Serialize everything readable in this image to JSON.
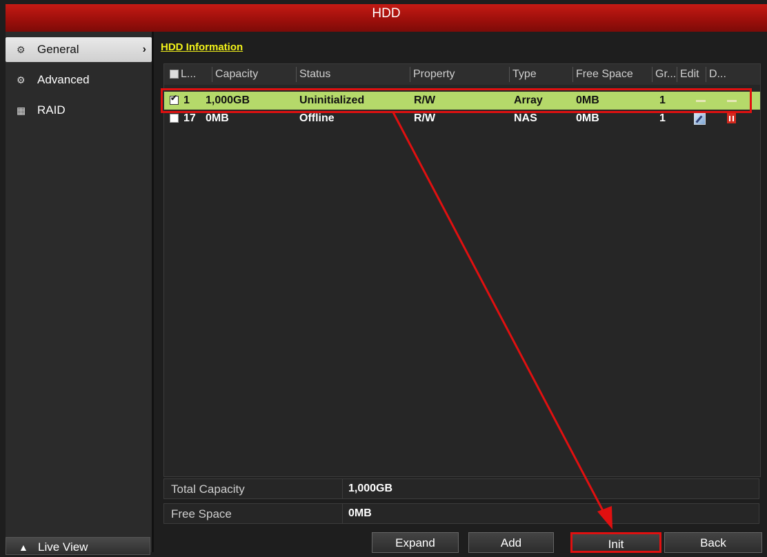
{
  "window": {
    "title": "HDD"
  },
  "sidebar": {
    "items": [
      {
        "label": "General",
        "icon": "gear-icon",
        "active": true
      },
      {
        "label": "Advanced",
        "icon": "gear-advanced-icon",
        "active": false
      },
      {
        "label": "RAID",
        "icon": "raid-grid-icon",
        "active": false
      }
    ],
    "live_view": {
      "label": "Live View",
      "icon": "home-icon"
    }
  },
  "main": {
    "section_title": "HDD Information",
    "columns": [
      "L...",
      "Capacity",
      "Status",
      "Property",
      "Type",
      "Free Space",
      "Gr...",
      "Edit",
      "D..."
    ],
    "rows": [
      {
        "label": "1",
        "capacity": "1,000GB",
        "status": "Uninitialized",
        "property": "R/W",
        "type": "Array",
        "free_space": "0MB",
        "group": "1",
        "checked": true,
        "selected": true
      },
      {
        "label": "17",
        "capacity": "0MB",
        "status": "Offline",
        "property": "R/W",
        "type": "NAS",
        "free_space": "0MB",
        "group": "1",
        "checked": false,
        "selected": false
      }
    ],
    "summary": {
      "total_capacity_label": "Total Capacity",
      "total_capacity_value": "1,000GB",
      "free_space_label": "Free Space",
      "free_space_value": "0MB"
    },
    "buttons": {
      "expand": "Expand",
      "add": "Add",
      "init": "Init",
      "back": "Back"
    }
  },
  "colors": {
    "title_bar": "#b0120d",
    "selected_row": "#b5d96a",
    "section_title": "#f3f31a",
    "annotation": "#e01010"
  }
}
